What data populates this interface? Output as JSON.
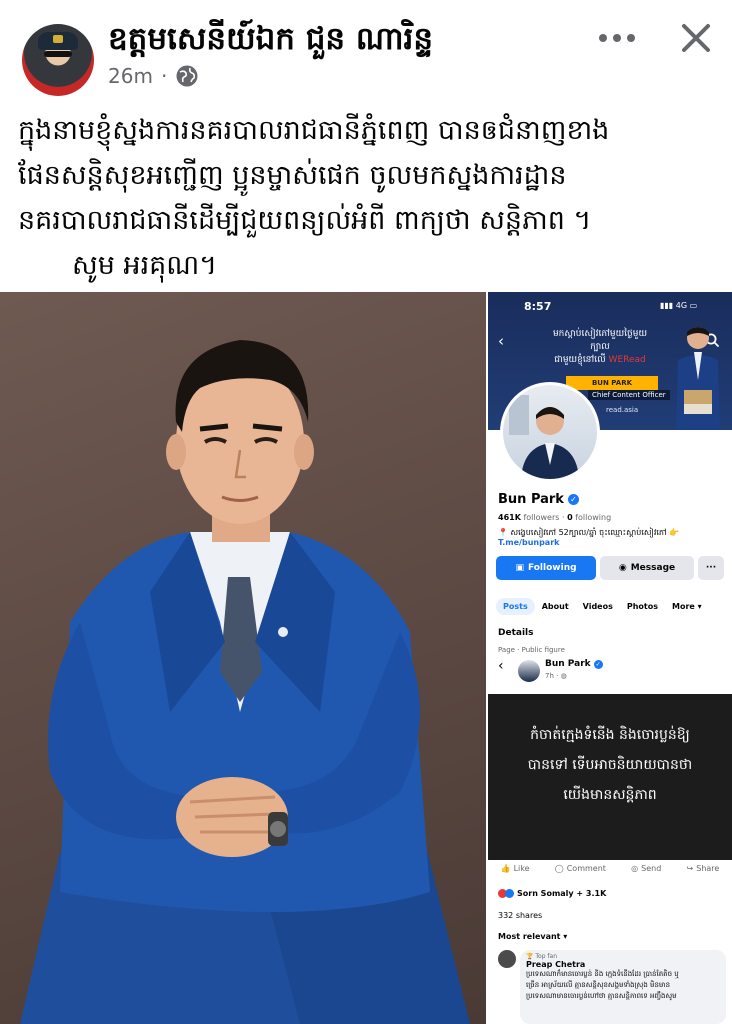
{
  "post": {
    "author": "ឧត្តមសេនីយ៍ឯក ជួន ណារិន្ទ",
    "time": "26m",
    "privacy_icon": "globe-icon",
    "text_lines": [
      "ក្នុងនាមខ្ញុំស្នងការនគរបាលរាជធានីភ្នំពេញ បានឲជំនាញខាង",
      "ផែនសន្តិសុខអញ្ជើញ ប្អូនម្ចាស់ផេក ចូលមកស្នងការដ្ឋាន",
      "នគរបាលរាជធានីដើម្បីជួយពន្យល់អំពី ពាក្យថា សន្តិភាព ។",
      "សូម អរគុណ។"
    ]
  },
  "phone": {
    "status_time": "8:57",
    "status_network": "4G",
    "cover": {
      "line1": "មកស្តាប់សៀវភៅមួយថ្ងៃមួយក្បាល",
      "line2": "ជាមួយខ្ញុំនៅលើ",
      "line2_accent": "WERead",
      "banner": "BUN PARK",
      "role": "Chief Content Officer",
      "site": "read.asia"
    },
    "profile": {
      "name": "Bun Park",
      "followers": "461K",
      "followers_label": "followers",
      "following": "0",
      "following_label": "following",
      "bio": "📍 សង្ខេបសៀវភៅ 52ក្បាល/ឆ្នាំ ចុះឈ្មោះស្តាប់សៀវភៅ 👉",
      "link": "T.me/bunpark"
    },
    "buttons": {
      "following": "Following",
      "message": "Message",
      "more": "···"
    },
    "tabs": [
      "Posts",
      "About",
      "Videos",
      "Photos",
      "More ▾"
    ],
    "details_title": "Details",
    "details_sub": "Page · Public figure",
    "shared_post": {
      "name": "Bun Park",
      "time": "7h · ",
      "card_lines": [
        "កំចាត់ក្មេងទំនើង និងចោរប្លន់ឱ្យ",
        "បានទៅ ទើបអាចនិយាយបានថា",
        "យើងមានសន្តិភាព"
      ]
    },
    "actions": [
      "Like",
      "Comment",
      "Send",
      "Share"
    ],
    "reactions_text": "Sorn Somaly + 3.1K",
    "shares_text": "332 shares",
    "sort_label": "Most relevant ▾",
    "comment": {
      "badge": "🏆 Top fan",
      "name": "Preap Chetra",
      "lines": [
        "ប្រទេសណាក៏មានចោរប្លន់ និង ក្មេងទំនើងដែរ ប្រាន់តែតិច ឬ",
        "ច្រើន អាស្រ័យលើ គ្មានសន្តិសុខសង្គមទាំងស្រុង មិនមាន",
        "ប្រទេសណាមានចោរប្លន់ហៅថា គ្មានសន្តិភាពទេ អញ្ចឹងសូម"
      ]
    }
  },
  "colors": {
    "facebook_blue": "#1877f2",
    "secondary_text": "#65676b",
    "card_black": "#1c1c1c"
  }
}
